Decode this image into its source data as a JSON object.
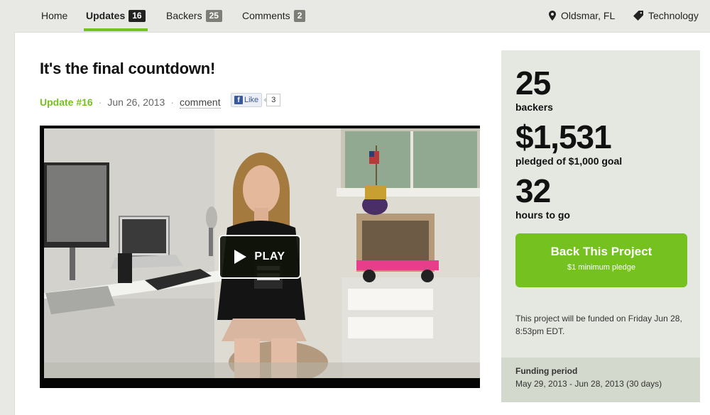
{
  "nav": {
    "home": "Home",
    "updates": {
      "label": "Updates",
      "count": "16"
    },
    "backers": {
      "label": "Backers",
      "count": "25"
    },
    "comments": {
      "label": "Comments",
      "count": "2"
    },
    "location": "Oldsmar, FL",
    "category": "Technology"
  },
  "post": {
    "title": "It's the final countdown!",
    "update_label": "Update #16",
    "date": "Jun 26, 2013",
    "comment_link": "comment",
    "fb_like_label": "Like",
    "fb_like_count": "3"
  },
  "video": {
    "play_label": "PLAY"
  },
  "stats": {
    "backers_count": "25",
    "backers_label": "backers",
    "pledged_amount": "$1,531",
    "pledged_label": "pledged of $1,000 goal",
    "hours_count": "32",
    "hours_label": "hours to go"
  },
  "cta": {
    "title": "Back This Project",
    "subtitle": "$1 minimum pledge"
  },
  "funded_note": "This project will be funded on Friday Jun 28, 8:53pm EDT.",
  "funding_period": {
    "heading": "Funding period",
    "range": "May 29, 2013 - Jun 28, 2013 (30 days)"
  },
  "colors": {
    "accent_green": "#74c11f",
    "sidebar_bg": "#e5e8e1",
    "period_bg": "#d4d9ce"
  },
  "icons": [
    "map-pin-icon",
    "tag-icon",
    "play-icon",
    "facebook-icon"
  ]
}
